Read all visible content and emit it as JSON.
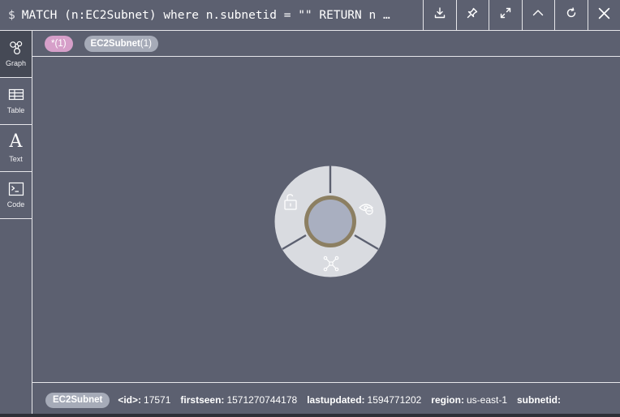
{
  "query": {
    "prompt": "$",
    "text": "MATCH (n:EC2Subnet) where n.subnetid = \"\" RETURN n …"
  },
  "toolbar": [
    {
      "name": "download-icon"
    },
    {
      "name": "pin-icon"
    },
    {
      "name": "fullscreen-icon"
    },
    {
      "name": "collapse-icon"
    },
    {
      "name": "rerun-icon"
    },
    {
      "name": "close-icon"
    }
  ],
  "rail": [
    {
      "label": "Graph",
      "icon": "graph-icon",
      "active": true
    },
    {
      "label": "Table",
      "icon": "table-icon",
      "active": false
    },
    {
      "label": "Text",
      "icon": "text-icon",
      "glyph": "A",
      "active": false
    },
    {
      "label": "Code",
      "icon": "code-icon",
      "active": false
    }
  ],
  "chips": [
    {
      "label": "*",
      "count": "(1)",
      "color": "#d69fc9"
    },
    {
      "label": "EC2Subnet",
      "count": "(1)",
      "color": "#a6abb8"
    }
  ],
  "node": {
    "fill": "#a9afc0",
    "ring": "#8c7f62",
    "menu_bg": "#d9dbe0",
    "actions": [
      "unlock-icon",
      "hide-icon",
      "expand-icon"
    ]
  },
  "details": {
    "label": "EC2Subnet",
    "props": [
      {
        "key": "<id>:",
        "value": "17571"
      },
      {
        "key": "firstseen:",
        "value": "1571270744178"
      },
      {
        "key": "lastupdated:",
        "value": "1594771202"
      },
      {
        "key": "region:",
        "value": "us-east-1"
      },
      {
        "key": "subnetid:",
        "value": ""
      }
    ]
  }
}
